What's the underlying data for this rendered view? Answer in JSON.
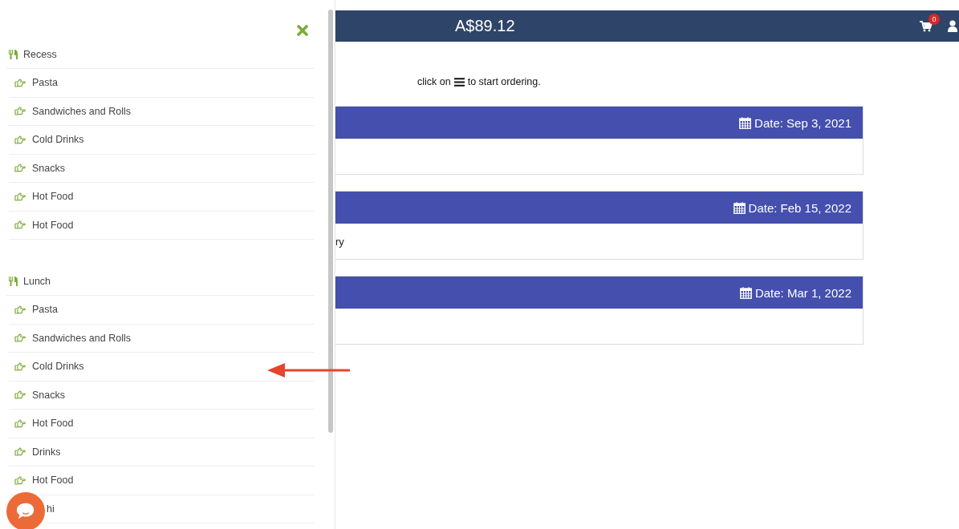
{
  "menu": [
    {
      "title": "Recess",
      "items": [
        "Pasta",
        "Sandwiches and Rolls",
        "Cold Drinks",
        "Snacks",
        "Hot Food",
        "Hot Food"
      ]
    },
    {
      "title": "Lunch",
      "items": [
        "Pasta",
        "Sandwiches and Rolls",
        "Cold Drinks",
        "Snacks",
        "Hot Food",
        "Drinks",
        "Hot Food",
        "hi"
      ]
    }
  ],
  "balance": "A$89.12",
  "cart_count": "0",
  "instruction": {
    "before": "click on",
    "after": "to start ordering."
  },
  "orders": [
    {
      "date": "Date: Sep 3, 2021"
    },
    {
      "date": "Date: Feb 15, 2022",
      "body": "ry"
    },
    {
      "date": "Date: Mar 1, 2022"
    }
  ]
}
